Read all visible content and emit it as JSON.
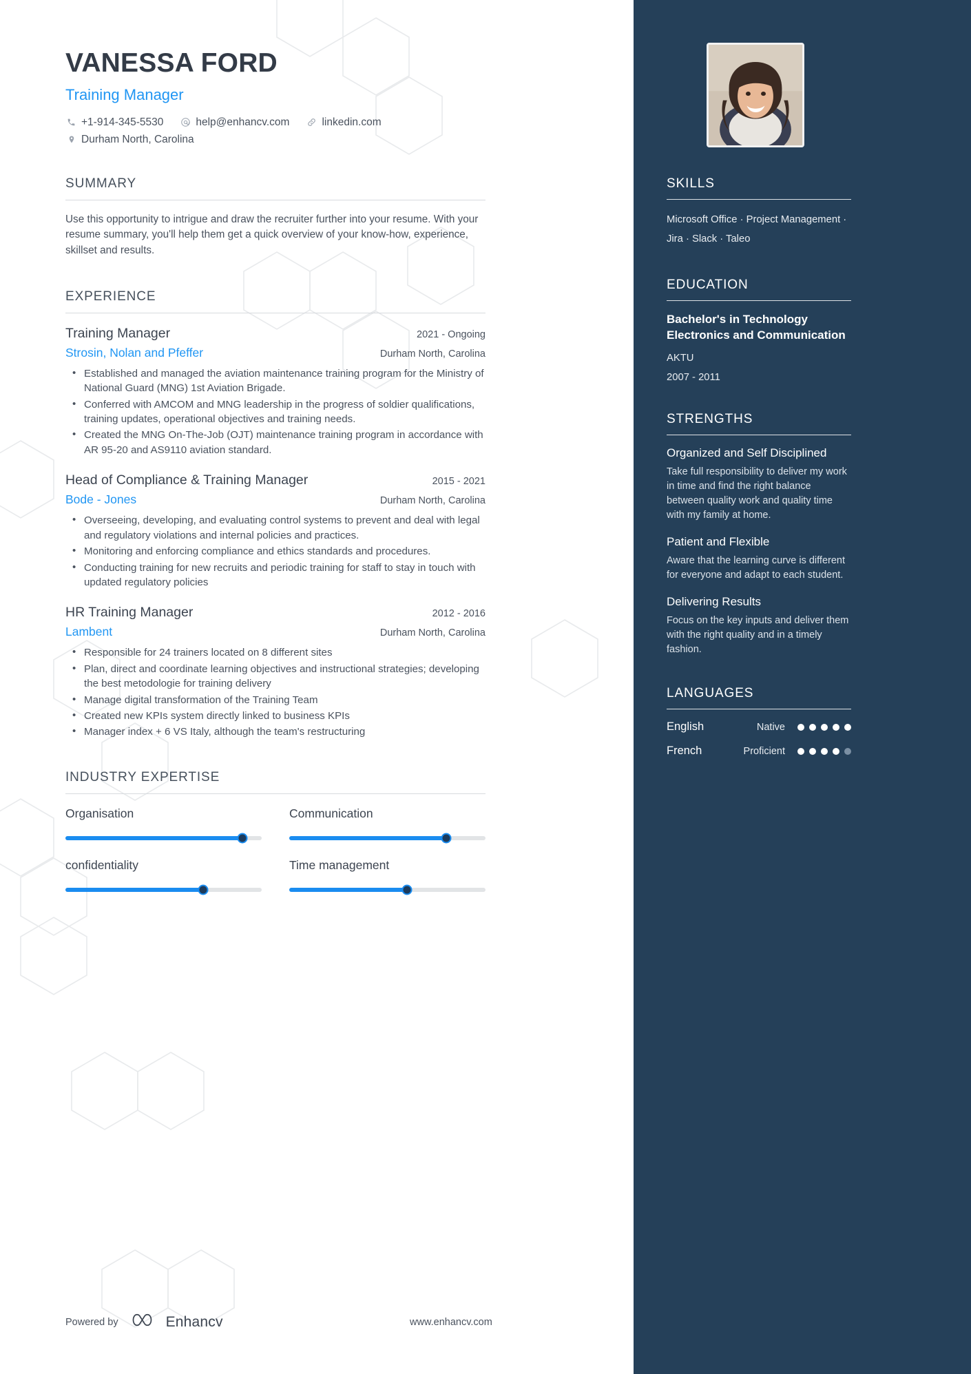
{
  "header": {
    "name": "VANESSA FORD",
    "job_title": "Training Manager",
    "phone": "+1-914-345-5530",
    "email": "help@enhancv.com",
    "linkedin": "linkedin.com",
    "location": "Durham North, Carolina"
  },
  "summary": {
    "title": "SUMMARY",
    "text": "Use this opportunity to intrigue and draw the recruiter further into your resume. With your resume summary, you'll help them get a quick overview of your know-how, experience, skillset and results."
  },
  "experience": {
    "title": "EXPERIENCE",
    "jobs": [
      {
        "role": "Training Manager",
        "dates": "2021 - Ongoing",
        "company": "Strosin, Nolan and Pfeffer",
        "location": "Durham North, Carolina",
        "bullets": [
          "Established and managed the aviation maintenance training program for the Ministry of National Guard (MNG) 1st Aviation Brigade.",
          "Conferred with AMCOM and MNG leadership in the progress of soldier qualifications, training updates, operational objectives and training needs.",
          "Created the MNG On-The-Job (OJT) maintenance training program in accordance with AR 95-20 and AS9110 aviation standard."
        ]
      },
      {
        "role": "Head of Compliance & Training Manager",
        "dates": "2015 - 2021",
        "company": "Bode - Jones",
        "location": "Durham North, Carolina",
        "bullets": [
          "Overseeing, developing, and evaluating control systems to prevent and deal with legal and regulatory violations and internal policies and practices.",
          "Monitoring and enforcing compliance and ethics standards and procedures.",
          "Conducting training for new recruits and periodic training for staff to stay in touch with updated regulatory policies"
        ]
      },
      {
        "role": "HR Training Manager",
        "dates": "2012 - 2016",
        "company": "Lambent",
        "location": "Durham North, Carolina",
        "bullets": [
          "Responsible for 24 trainers located on 8 different sites",
          "Plan, direct and coordinate learning objectives and instructional strategies; developing the best metodologie for training delivery",
          "Manage digital transformation of the Training Team",
          "Created new KPIs system directly linked to business KPIs",
          "Manager index + 6 VS Italy, although the team's restructuring"
        ]
      }
    ]
  },
  "industry_expertise": {
    "title": "INDUSTRY EXPERTISE",
    "items": [
      {
        "label": "Organisation",
        "value": 90
      },
      {
        "label": "Communication",
        "value": 80
      },
      {
        "label": "confidentiality",
        "value": 70
      },
      {
        "label": "Time management",
        "value": 60
      }
    ]
  },
  "footer": {
    "powered_by": "Powered by",
    "brand": "Enhancv",
    "website": "www.enhancv.com"
  },
  "sidebar": {
    "skills": {
      "title": "SKILLS",
      "line1": "Microsoft Office · Project Management ·",
      "line2": "Jira · Slack · Taleo"
    },
    "education": {
      "title": "EDUCATION",
      "degree": "Bachelor's in Technology Electronics and Communication",
      "school": "AKTU",
      "dates": "2007 - 2011"
    },
    "strengths": {
      "title": "STRENGTHS",
      "items": [
        {
          "title": "Organized and Self Disciplined",
          "text": "Take full responsibility to deliver my work in time and find the right balance between quality work and quality time with my family at home."
        },
        {
          "title": "Patient and Flexible",
          "text": "Aware that the learning curve is different for everyone and adapt to each student."
        },
        {
          "title": "Delivering Results",
          "text": "Focus on the key inputs and deliver them with the right quality and in a timely fashion."
        }
      ]
    },
    "languages": {
      "title": "LANGUAGES",
      "items": [
        {
          "name": "English",
          "level": "Native",
          "filled": 5,
          "total": 5
        },
        {
          "name": "French",
          "level": "Proficient",
          "filled": 4,
          "total": 5
        }
      ]
    }
  },
  "colors": {
    "accent": "#2196f3",
    "sidebar_bg": "#254059",
    "slider_fill": "#1a8cf0",
    "text": "#4a525e"
  }
}
